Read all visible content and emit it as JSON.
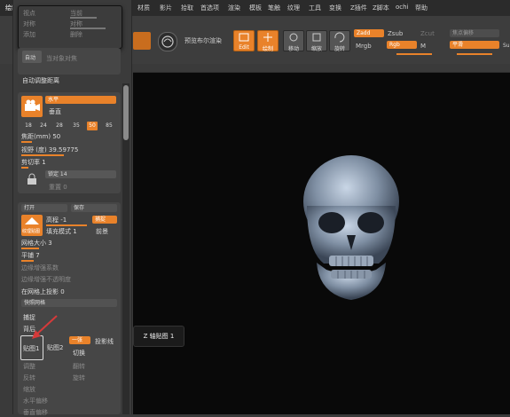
{
  "menu": {
    "items": [
      "绘制",
      "编辑",
      "文件",
      "图层",
      "灯光",
      "宏",
      "标记",
      "材质",
      "影片",
      "拾取",
      "首选项",
      "渲染",
      "模板",
      "笔触",
      "纹理",
      "工具",
      "变换",
      "Z插件",
      "Z脚本",
      "ochi",
      "帮助"
    ]
  },
  "shelf": {
    "render_label": "预览布尔渲染",
    "edit": "Edit",
    "draw": "绘制",
    "move": "移动",
    "scale": "缩放",
    "rotate": "旋转",
    "zadd": "Zadd",
    "zsub": "Zsub",
    "zcut": "Zcut",
    "mrgb": "Mrgb",
    "rgb": "Rgb",
    "m": "M",
    "focal_shift": "焦点偏移",
    "smooth": "平滑",
    "su": "Su"
  },
  "popup": {
    "row1_a": "视点",
    "row1_b": "当前",
    "row2_a": "对称",
    "row2_b": "对称",
    "row3_a": "添加",
    "row3_b": "删除",
    "auto_label": "自动",
    "row4": "当对象对焦",
    "auto_adjust": "自动调整距离"
  },
  "camera": {
    "horizontal": "水平",
    "vertical": "垂直",
    "fov_presets": [
      "18",
      "24",
      "28",
      "35",
      "50",
      "85"
    ],
    "fov_selected": "50",
    "focal_length": "焦距(mm) 50",
    "angle": "视野 (度) 39.59775",
    "clip": "剪切率 1",
    "lock": "锁定",
    "lock_val": "锁定 14",
    "reset": "重置 0"
  },
  "grid": {
    "open": "打开",
    "save": "保存",
    "texture": "纹理贴图",
    "elevation": "高程 -1",
    "fill_mode": "填充模式 1",
    "capture": "捕捉",
    "front": "前景",
    "grid_size": "网格大小 3",
    "tiles": "平铺 7",
    "grid_opacity": "边缘增强系数",
    "edge_opacity": "边缘增强不透明度",
    "shadow": "在网格上投影 0",
    "quick_grid": "快照网格",
    "snap": "捕捉",
    "back": "背后",
    "map1": "贴图1",
    "map2": "贴图2",
    "one_sheet": "一张",
    "proj_line": "投影线",
    "toggle": "切换",
    "adjust": "调整",
    "flip": "翻转",
    "invert": "反转",
    "rotate": "旋转",
    "scale": "缩放",
    "h_offset": "水平偏移",
    "v_offset": "垂直偏移"
  },
  "tooltip": "Z 轴贴图 1",
  "colors": {
    "accent": "#e9822a",
    "panel": "#3b3b3b",
    "viewport": "#090909",
    "arrow": "#d63a3a"
  }
}
